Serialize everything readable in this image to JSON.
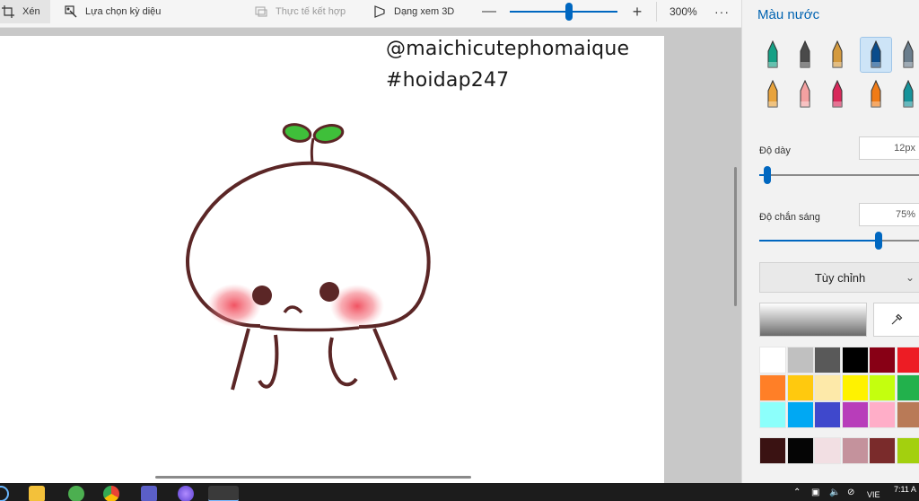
{
  "toolbar": {
    "crop_label": "Xén",
    "magic_select_label": "Lựa chọn kỳ diệu",
    "mixed_reality_label": "Thực tế kết hợp",
    "view_3d_label": "Dạng xem 3D",
    "zoom_minus": "—",
    "zoom_plus": "+",
    "zoom_level": "300%",
    "zoom_fraction": 0.55,
    "more": "···"
  },
  "canvas": {
    "watermark_1": "@maichicutephomaique",
    "watermark_2": "#hoidap247"
  },
  "panel": {
    "title": "Màu nước",
    "brushes": [
      {
        "name": "calligraphy-pen",
        "color": "#15a085",
        "selected": false
      },
      {
        "name": "fountain-pen",
        "color": "#4a4a4a",
        "selected": false
      },
      {
        "name": "oil-brush",
        "color": "#d49a3e",
        "selected": false
      },
      {
        "name": "watercolor",
        "color": "#0a4c8c",
        "selected": true
      },
      {
        "name": "pen",
        "color": "#6a7d8c",
        "selected": false
      },
      {
        "name": "pencil",
        "color": "#e8a33c",
        "selected": false
      },
      {
        "name": "eraser",
        "color": "#f4a1a1",
        "selected": false
      },
      {
        "name": "crayon",
        "color": "#d8285a",
        "selected": false
      },
      {
        "name": "spray-can",
        "color": "#f07b16",
        "selected": false
      },
      {
        "name": "fill",
        "color": "#16939a",
        "selected": false
      }
    ],
    "thickness_label": "Độ dày",
    "thickness_value": "12px",
    "thickness_fraction": 0.05,
    "opacity_label": "Độ chắn sáng",
    "opacity_value": "75%",
    "opacity_fraction": 0.74,
    "custom_label": "Tùy chỉnh",
    "palette_rows": [
      [
        "#ffffff",
        "#c0c0c0",
        "#595959",
        "#000000",
        "#880015",
        "#ed1c24"
      ],
      [
        "#ff7f27",
        "#ffc90e",
        "#fde9a9",
        "#fff200",
        "#c4ff0e",
        "#22b14c"
      ],
      [
        "#8cfffb",
        "#00a8f3",
        "#3f48cc",
        "#b83dba",
        "#ffaec8",
        "#b97a57"
      ],
      [
        "#3a1212",
        "#050505",
        "#f2dfe3",
        "#c4929c",
        "#7a2b2b",
        "#a3d00e"
      ]
    ]
  },
  "taskbar": {
    "lang": "VIE",
    "time": "7:11 A"
  }
}
